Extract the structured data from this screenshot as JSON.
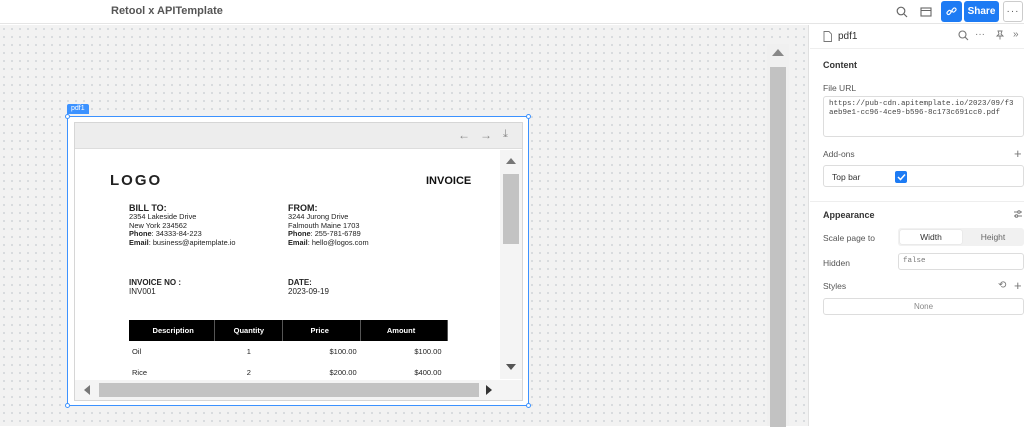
{
  "app": {
    "title": "Retool x APITemplate"
  },
  "topbar": {
    "share_label": "Share",
    "more_label": "···"
  },
  "component": {
    "name": "pdf1",
    "tag_label": "pdf1"
  },
  "invoice": {
    "logo": "LOGO",
    "title": "INVOICE",
    "bill_to": {
      "heading": "BILL TO:",
      "line1": "2354 Lakeside Drive",
      "line2": "New York 234562",
      "phone_label": "Phone",
      "phone": ": 34333-84-223",
      "email_label": "Email",
      "email": ": business@apitemplate.io"
    },
    "from": {
      "heading": "FROM:",
      "line1": "3244 Jurong Drive",
      "line2": "Falmouth Maine 1703",
      "phone_label": "Phone",
      "phone": ": 255-781-6789",
      "email_label": "Email",
      "email": ": hello@logos.com"
    },
    "invoice_no": {
      "label": "INVOICE NO :",
      "value": "INV001"
    },
    "date": {
      "label": "DATE:",
      "value": "2023-09-19"
    },
    "table": {
      "headers": [
        "Description",
        "Quantity",
        "Price",
        "Amount"
      ],
      "rows": [
        {
          "description": "Oil",
          "quantity": "1",
          "price": "$100.00",
          "amount": "$100.00"
        },
        {
          "description": "Rice",
          "quantity": "2",
          "price": "$200.00",
          "amount": "$400.00"
        }
      ]
    }
  },
  "panel": {
    "component_name": "pdf1",
    "content": {
      "title": "Content",
      "file_url_label": "File URL",
      "file_url": "https://pub-cdn.apitemplate.io/2023/09/f3aeb9e1-cc96-4ce9-b596-8c173c691cc0.pdf"
    },
    "addons": {
      "title": "Add-ons",
      "top_bar_label": "Top bar",
      "top_bar_checked": true
    },
    "appearance": {
      "title": "Appearance",
      "scale_label": "Scale page to",
      "scale_options": [
        "Width",
        "Height"
      ],
      "scale_selected": "Width",
      "hidden_label": "Hidden",
      "hidden_value": "false",
      "styles_label": "Styles",
      "styles_value": "None"
    }
  },
  "colors": {
    "accent": "#1d7bf4",
    "selection": "#3c92ff"
  }
}
